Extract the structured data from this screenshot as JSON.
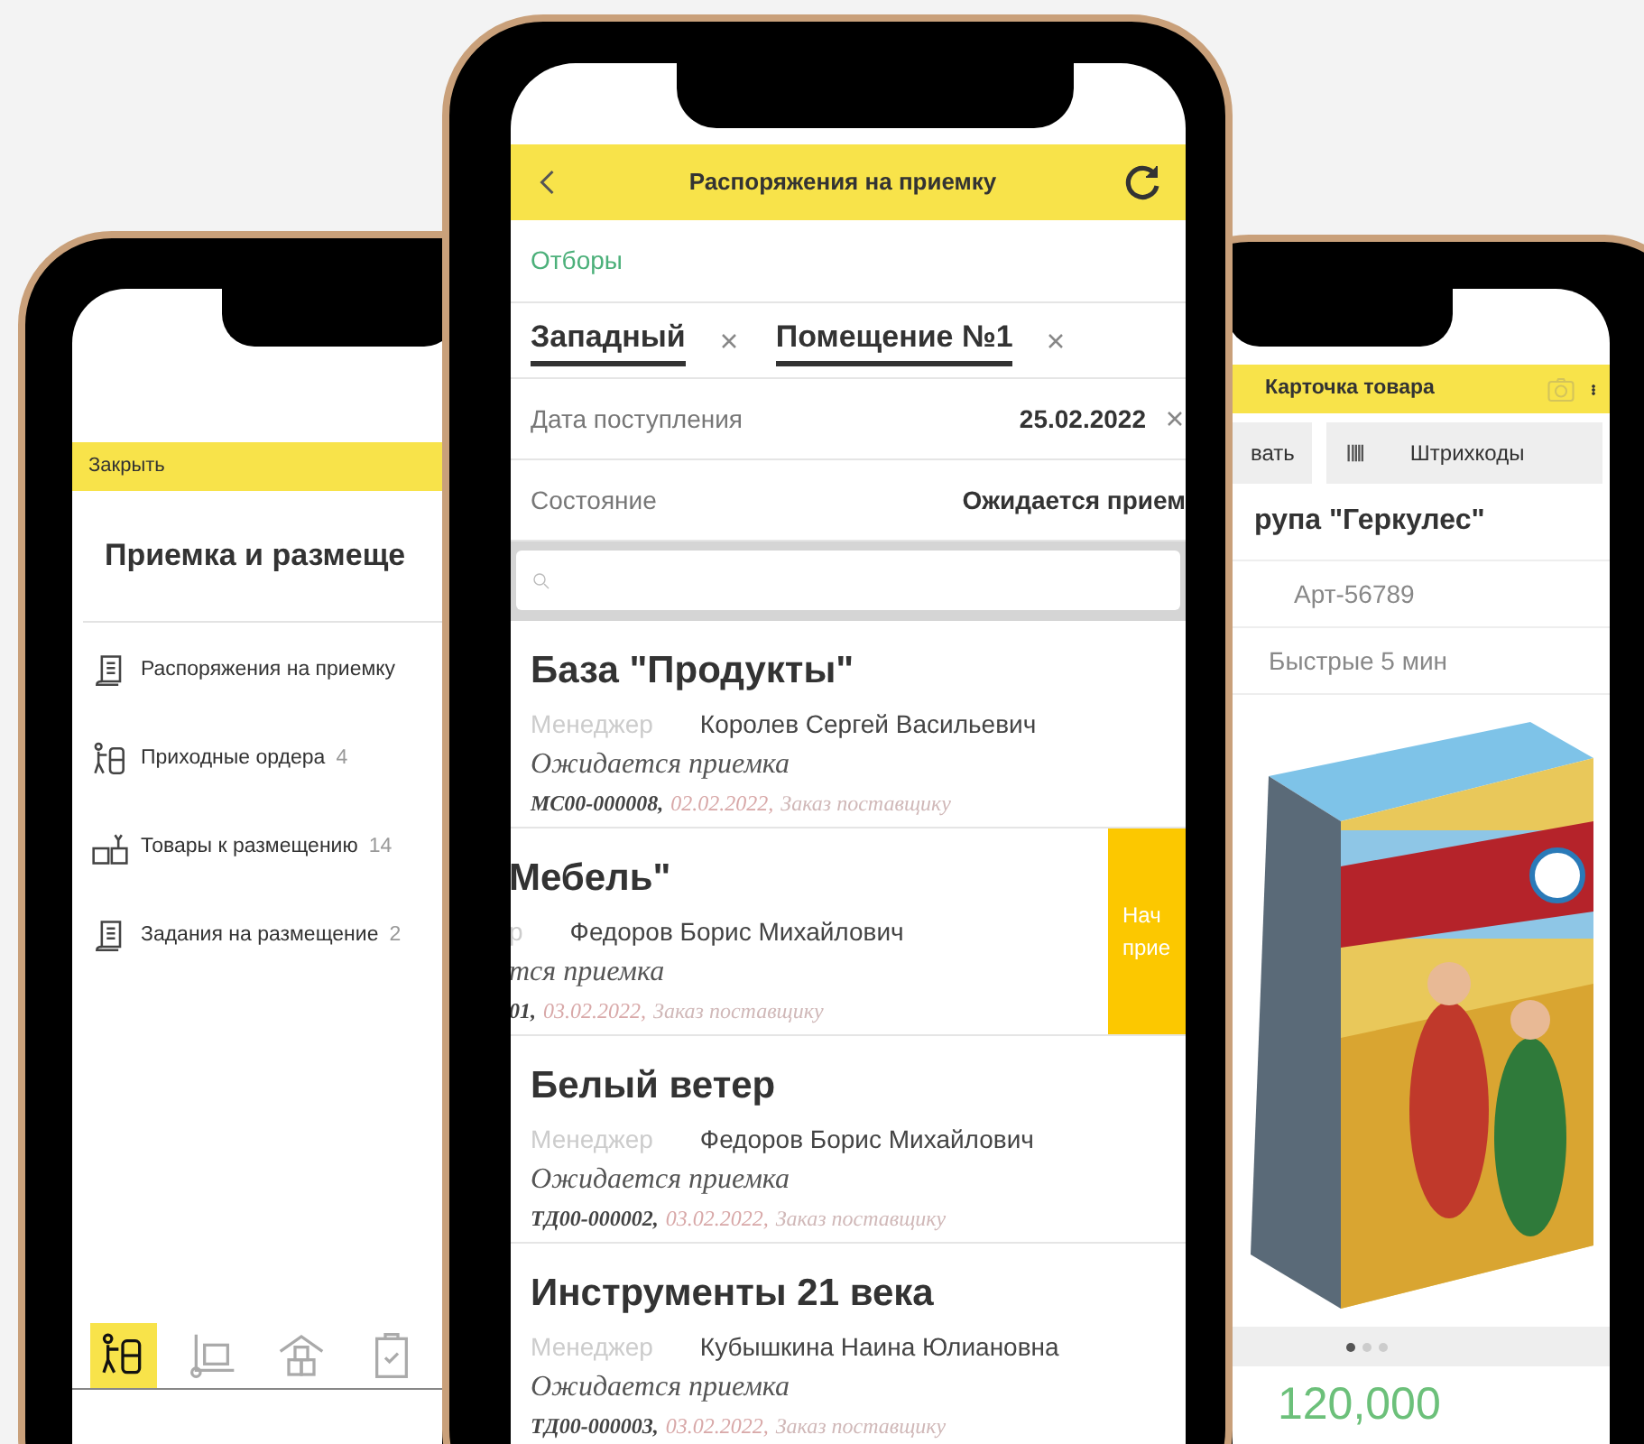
{
  "left_phone": {
    "header": {
      "close": "Закрыть"
    },
    "title": "Приемка и размеще",
    "menu": [
      {
        "kind": "document",
        "label": "Распоряжения на приемку"
      },
      {
        "kind": "worker",
        "label": "Приходные ордера",
        "count": "4"
      },
      {
        "kind": "goods",
        "label": "Товары к размещению",
        "count": "14"
      },
      {
        "kind": "document",
        "label": "Задания на размещение",
        "count": "2"
      }
    ],
    "tab_bar": [
      {
        "kind": "worker",
        "selected": true
      },
      {
        "kind": "trolley",
        "selected": false
      },
      {
        "kind": "warehouse",
        "selected": false
      },
      {
        "kind": "clipboard",
        "selected": false
      }
    ]
  },
  "middle_phone": {
    "header": {
      "title": "Распоряжения на приемку"
    },
    "filters_link": "Отборы",
    "chips": [
      {
        "label": "Западный"
      },
      {
        "label": "Помещение №1"
      }
    ],
    "fields": [
      {
        "label": "Дата поступления",
        "value": "25.02.2022",
        "clearable": true
      },
      {
        "label": "Состояние",
        "value": "Ожидается прием",
        "clearable": false
      }
    ],
    "orders": [
      {
        "title": "База \"Продукты\"",
        "manager_label": "Менеджер",
        "manager": "Королев Сергей Васильевич",
        "status": "Ожидается приемка",
        "number": "МС00-000008,",
        "date": "02.02.2022,",
        "doc": "Заказ поставщику",
        "swiped": false
      },
      {
        "title": "Мебель\"",
        "manager_label": "р",
        "manager": "Федоров Борис Михайлович",
        "status": "тся приемка",
        "number": "01,",
        "date": "03.02.2022,",
        "doc": "Заказ поставщику",
        "swiped": true,
        "action": [
          "Нач",
          "прие"
        ]
      },
      {
        "title": "Белый ветер",
        "manager_label": "Менеджер",
        "manager": "Федоров Борис Михайлович",
        "status": "Ожидается приемка",
        "number": "ТД00-000002,",
        "date": "03.02.2022,",
        "doc": "Заказ поставщику",
        "swiped": false
      },
      {
        "title": "Инструменты 21 века",
        "manager_label": "Менеджер",
        "manager": "Кубышкина Наина Юлиановна",
        "status": "Ожидается приемка",
        "number": "ТД00-000003,",
        "date": "03.02.2022,",
        "doc": "Заказ поставщику",
        "swiped": false
      }
    ]
  },
  "right_phone": {
    "header": {
      "title": "Карточка товара"
    },
    "tabs": [
      {
        "kind": "text",
        "label": "вать"
      },
      {
        "kind": "barcode",
        "label": "Штрихкоды"
      }
    ],
    "name": "рупа \"Геркулес\"",
    "article": "Арт-56789",
    "note": "Быстрые 5 мин",
    "pager": [
      {
        "selected": true
      },
      {
        "selected": false
      },
      {
        "selected": false
      }
    ],
    "price": "120,000"
  }
}
